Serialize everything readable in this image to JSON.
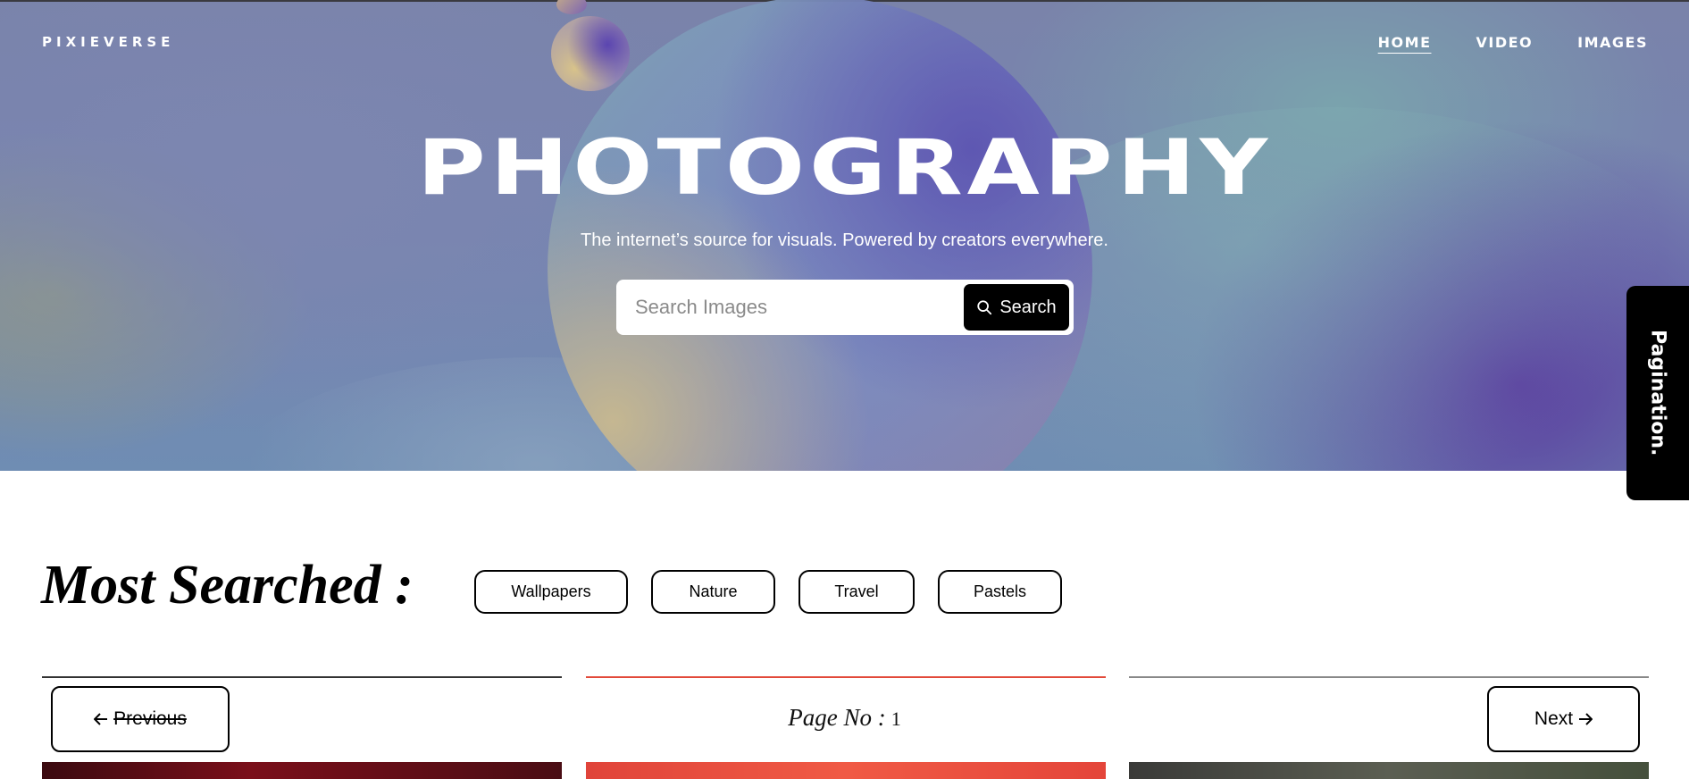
{
  "header": {
    "brand": "PIXIEVERSE",
    "nav": [
      {
        "label": "HOME",
        "active": true
      },
      {
        "label": "VIDEO",
        "active": false
      },
      {
        "label": "IMAGES",
        "active": false
      }
    ]
  },
  "hero": {
    "title": "PHOTOGRAPHY",
    "subtitle": "The internet’s source for visuals. Powered by creators everywhere.",
    "search": {
      "placeholder": "Search Images",
      "value": "",
      "button_label": "Search",
      "button_icon": "search-icon"
    }
  },
  "side_tab": {
    "label": "Pagination."
  },
  "most_searched": {
    "title": "Most Searched :",
    "tags": [
      "Wallpapers",
      "Nature",
      "Travel",
      "Pastels"
    ]
  },
  "pagination": {
    "previous_label": "Previous",
    "previous_icon": "arrow-left-icon",
    "next_label": "Next",
    "next_icon": "arrow-right-icon",
    "page_label": "Page No :",
    "page_number": "1"
  },
  "colors": {
    "accent": "#000000",
    "hero_purple": "#5b3fa0",
    "hero_blue": "#7684b1"
  }
}
